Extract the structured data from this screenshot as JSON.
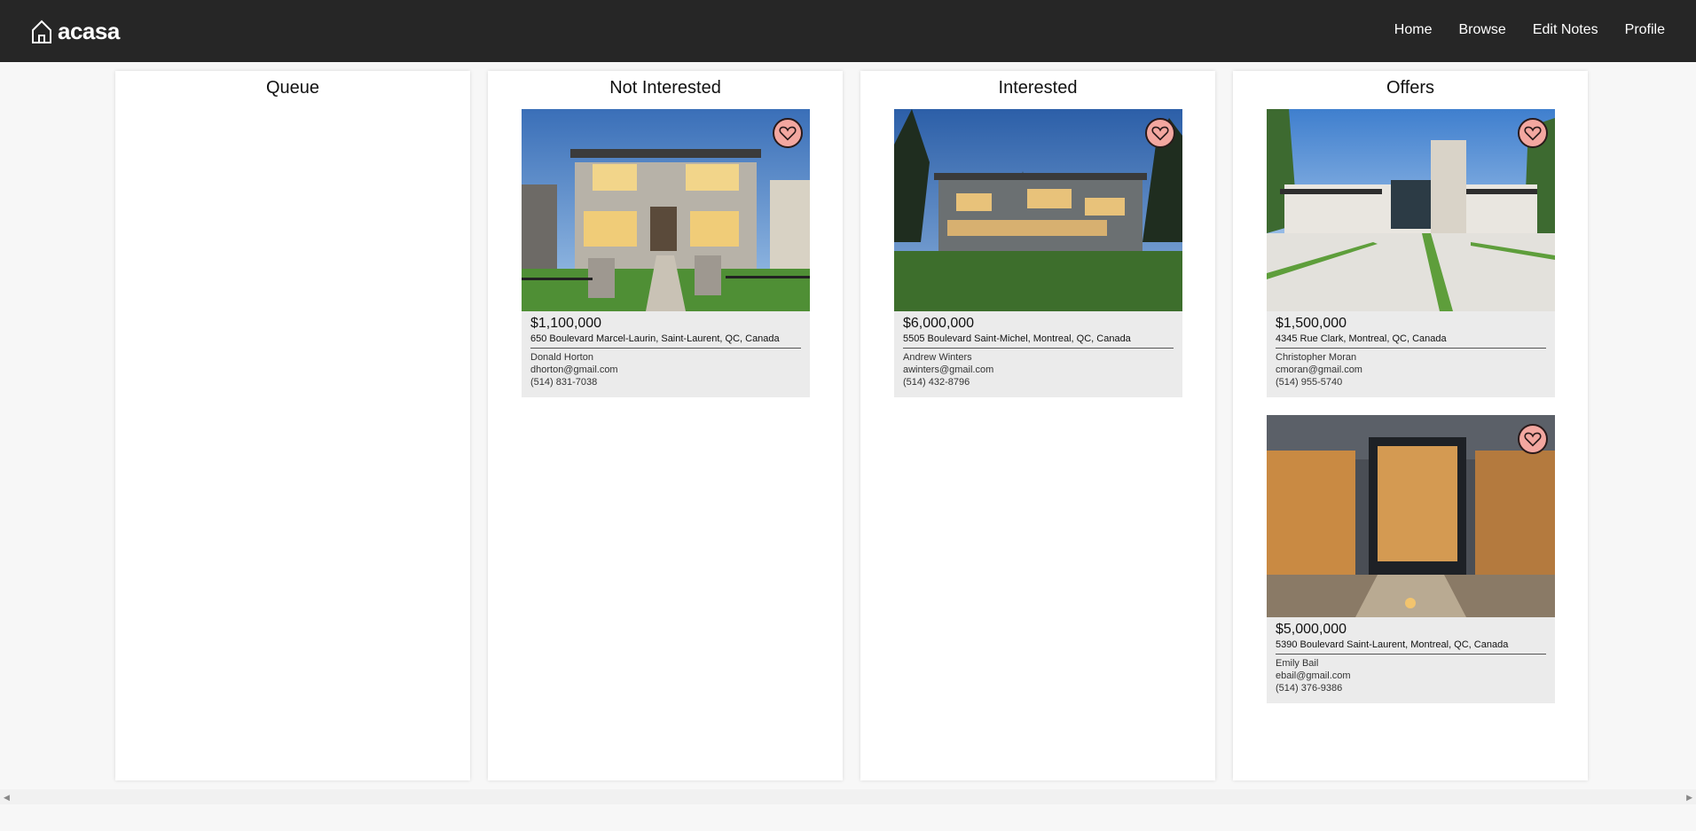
{
  "brand": {
    "name": "acasa",
    "icon": "house-icon"
  },
  "nav": {
    "links": [
      "Home",
      "Browse",
      "Edit Notes",
      "Profile"
    ]
  },
  "columns": [
    {
      "title": "Queue",
      "cards": []
    },
    {
      "title": "Not Interested",
      "cards": [
        {
          "price": "$1,100,000",
          "address": "650 Boulevard Marcel-Laurin, Saint-Laurent, QC, Canada",
          "agent": "Donald Horton",
          "email": "dhorton@gmail.com",
          "phone": "(514) 831-7038"
        }
      ]
    },
    {
      "title": "Interested",
      "cards": [
        {
          "price": "$6,000,000",
          "address": "5505 Boulevard Saint-Michel, Montreal, QC, Canada",
          "agent": "Andrew Winters",
          "email": "awinters@gmail.com",
          "phone": "(514) 432-8796"
        }
      ]
    },
    {
      "title": "Offers",
      "cards": [
        {
          "price": "$1,500,000",
          "address": "4345 Rue Clark, Montreal, QC, Canada",
          "agent": "Christopher Moran",
          "email": "cmoran@gmail.com",
          "phone": "(514) 955-5740"
        },
        {
          "price": "$5,000,000",
          "address": "5390 Boulevard Saint-Laurent, Montreal, QC, Canada",
          "agent": "Emily Bail",
          "email": "ebail@gmail.com",
          "phone": "(514) 376-9386"
        }
      ]
    }
  ],
  "colors": {
    "navbar": "#262626",
    "heart": "#f3a7a0",
    "card": "#ebebeb"
  }
}
